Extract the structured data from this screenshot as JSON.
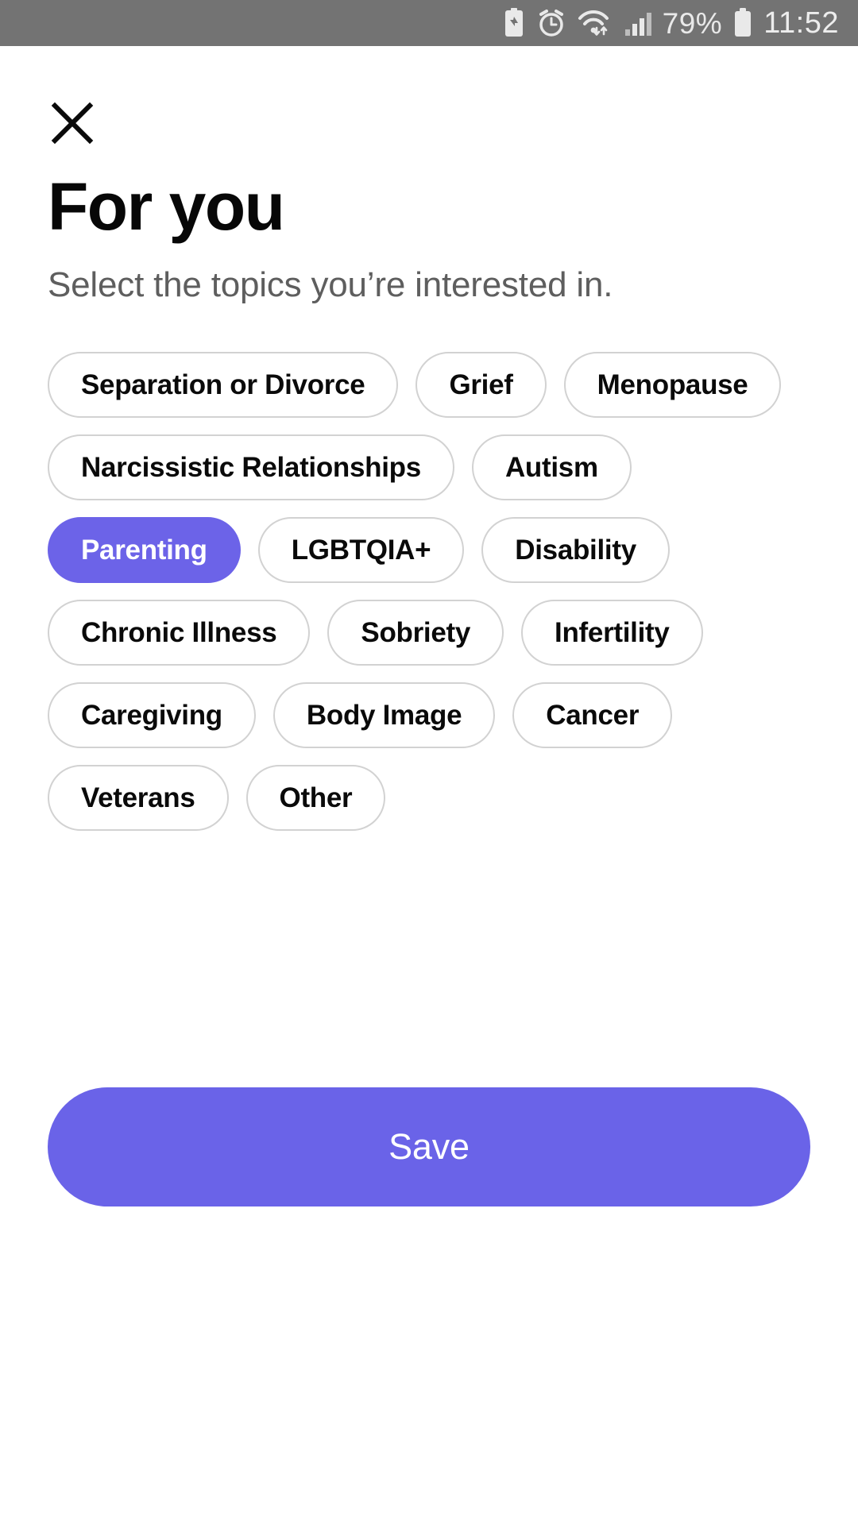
{
  "status_bar": {
    "background_color": "#737373",
    "icons": [
      {
        "name": "battery-saver-icon",
        "glyph": "♻"
      },
      {
        "name": "alarm-clock-icon",
        "glyph": "⏰"
      },
      {
        "name": "wifi-icon",
        "glyph": "wifi"
      },
      {
        "name": "cellular-signal-icon",
        "glyph": "signal"
      }
    ],
    "battery_percent": "79%",
    "battery_icon": "battery-icon",
    "clock": "11:52"
  },
  "header": {
    "close_icon": "close-icon",
    "title": "For you",
    "subtitle": "Select the topics you’re interested in."
  },
  "topics": [
    {
      "label": "Separation or Divorce",
      "selected": false
    },
    {
      "label": "Grief",
      "selected": false
    },
    {
      "label": "Menopause",
      "selected": false
    },
    {
      "label": "Narcissistic Relationships",
      "selected": false
    },
    {
      "label": "Autism",
      "selected": false
    },
    {
      "label": "Parenting",
      "selected": true
    },
    {
      "label": "LGBTQIA+",
      "selected": false
    },
    {
      "label": "Disability",
      "selected": false
    },
    {
      "label": "Chronic Illness",
      "selected": false
    },
    {
      "label": "Sobriety",
      "selected": false
    },
    {
      "label": "Infertility",
      "selected": false
    },
    {
      "label": "Caregiving",
      "selected": false
    },
    {
      "label": "Body Image",
      "selected": false
    },
    {
      "label": "Cancer",
      "selected": false
    },
    {
      "label": "Veterans",
      "selected": false
    },
    {
      "label": "Other",
      "selected": false
    }
  ],
  "footer": {
    "save_label": "Save"
  },
  "colors": {
    "accent": "#6A63E8",
    "chip_border": "#d2d2d2",
    "subtitle_text": "#5e5e5e",
    "status_bar": "#737373"
  }
}
